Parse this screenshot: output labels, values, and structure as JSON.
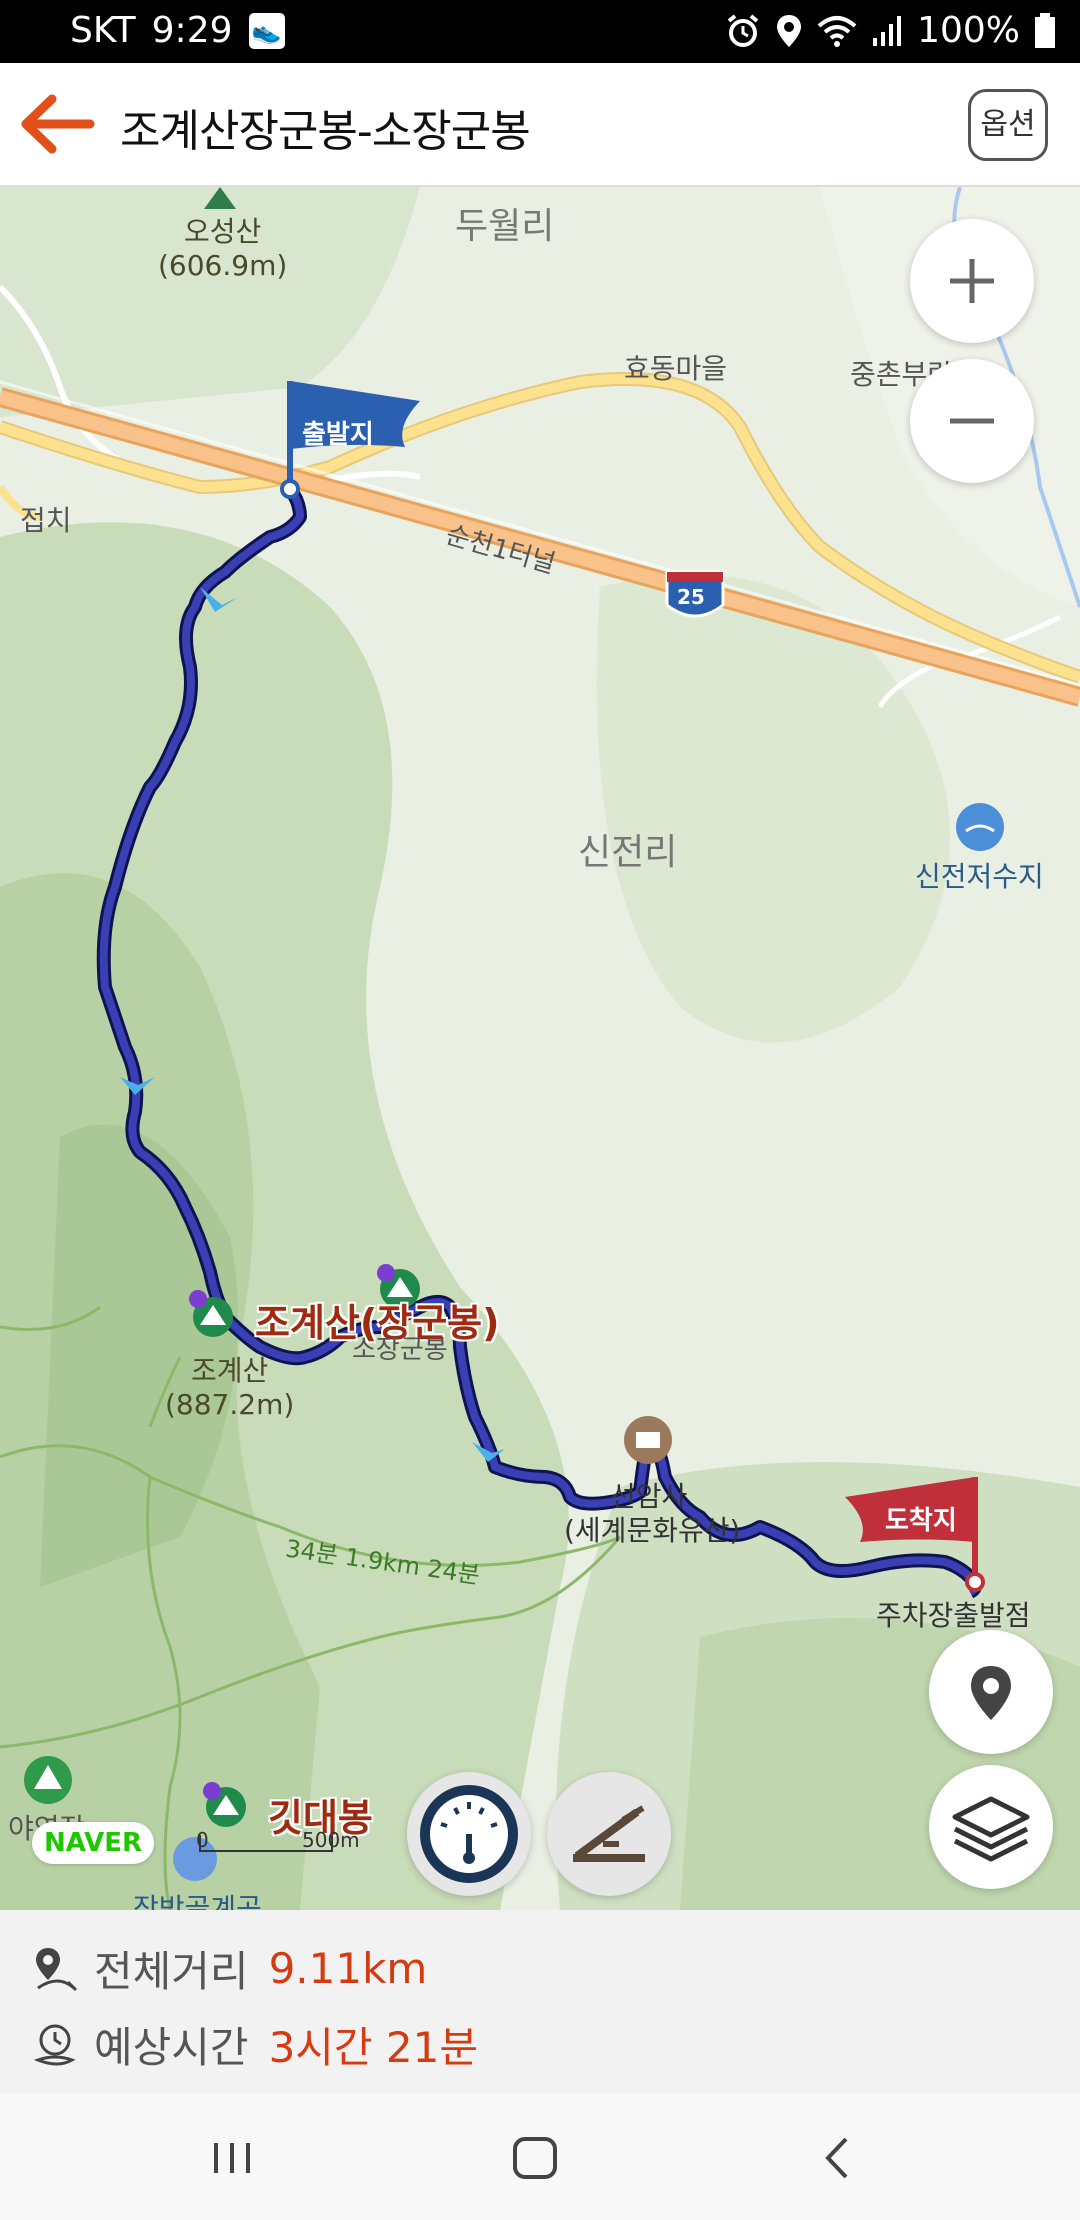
{
  "status_bar": {
    "carrier": "SKT",
    "time": "9:29",
    "battery": "100%",
    "icons": [
      "alarm-icon",
      "location-icon",
      "wifi-icon",
      "signal-icon",
      "battery-icon"
    ]
  },
  "header": {
    "title": "조계산장군봉-소장군봉",
    "option_label": "옵션"
  },
  "map": {
    "labels": {
      "oseongsan": "오성산",
      "oseongsan_alt": "(606.9m)",
      "duwolri": "두월리",
      "hyodong": "효동마을",
      "jungchon": "중촌부락",
      "jeopchi": "접치",
      "tunnel": "순천1터널",
      "highway_no": "25",
      "sinjeonri": "신전리",
      "reservoir": "신전저수지",
      "jogyesan_big": "조계산(장군봉)",
      "sojang": "소장군봉",
      "jogyesan": "조계산",
      "jogyesan_alt": "(887.2m)",
      "temple": "선암사",
      "temple_sub": "(세계문화유산)",
      "trail_info": "34분 1.9km 24분",
      "parking": "주차장출발점",
      "gitdae": "깃대봉",
      "camp": "야영장",
      "valley": "장박골계곡",
      "scale_0": "0",
      "scale_500": "500m"
    },
    "start_flag": "출발지",
    "end_flag": "도착지",
    "naver_logo": "NAVER",
    "colors": {
      "route": "#3a3fb4",
      "start_flag": "#2b5fb0",
      "end_flag": "#c0303a",
      "accent": "#e34f1b"
    }
  },
  "info": {
    "distance_label": "전체거리",
    "distance_value": "9.11km",
    "time_label": "예상시간",
    "time_value": "3시간 21분"
  }
}
